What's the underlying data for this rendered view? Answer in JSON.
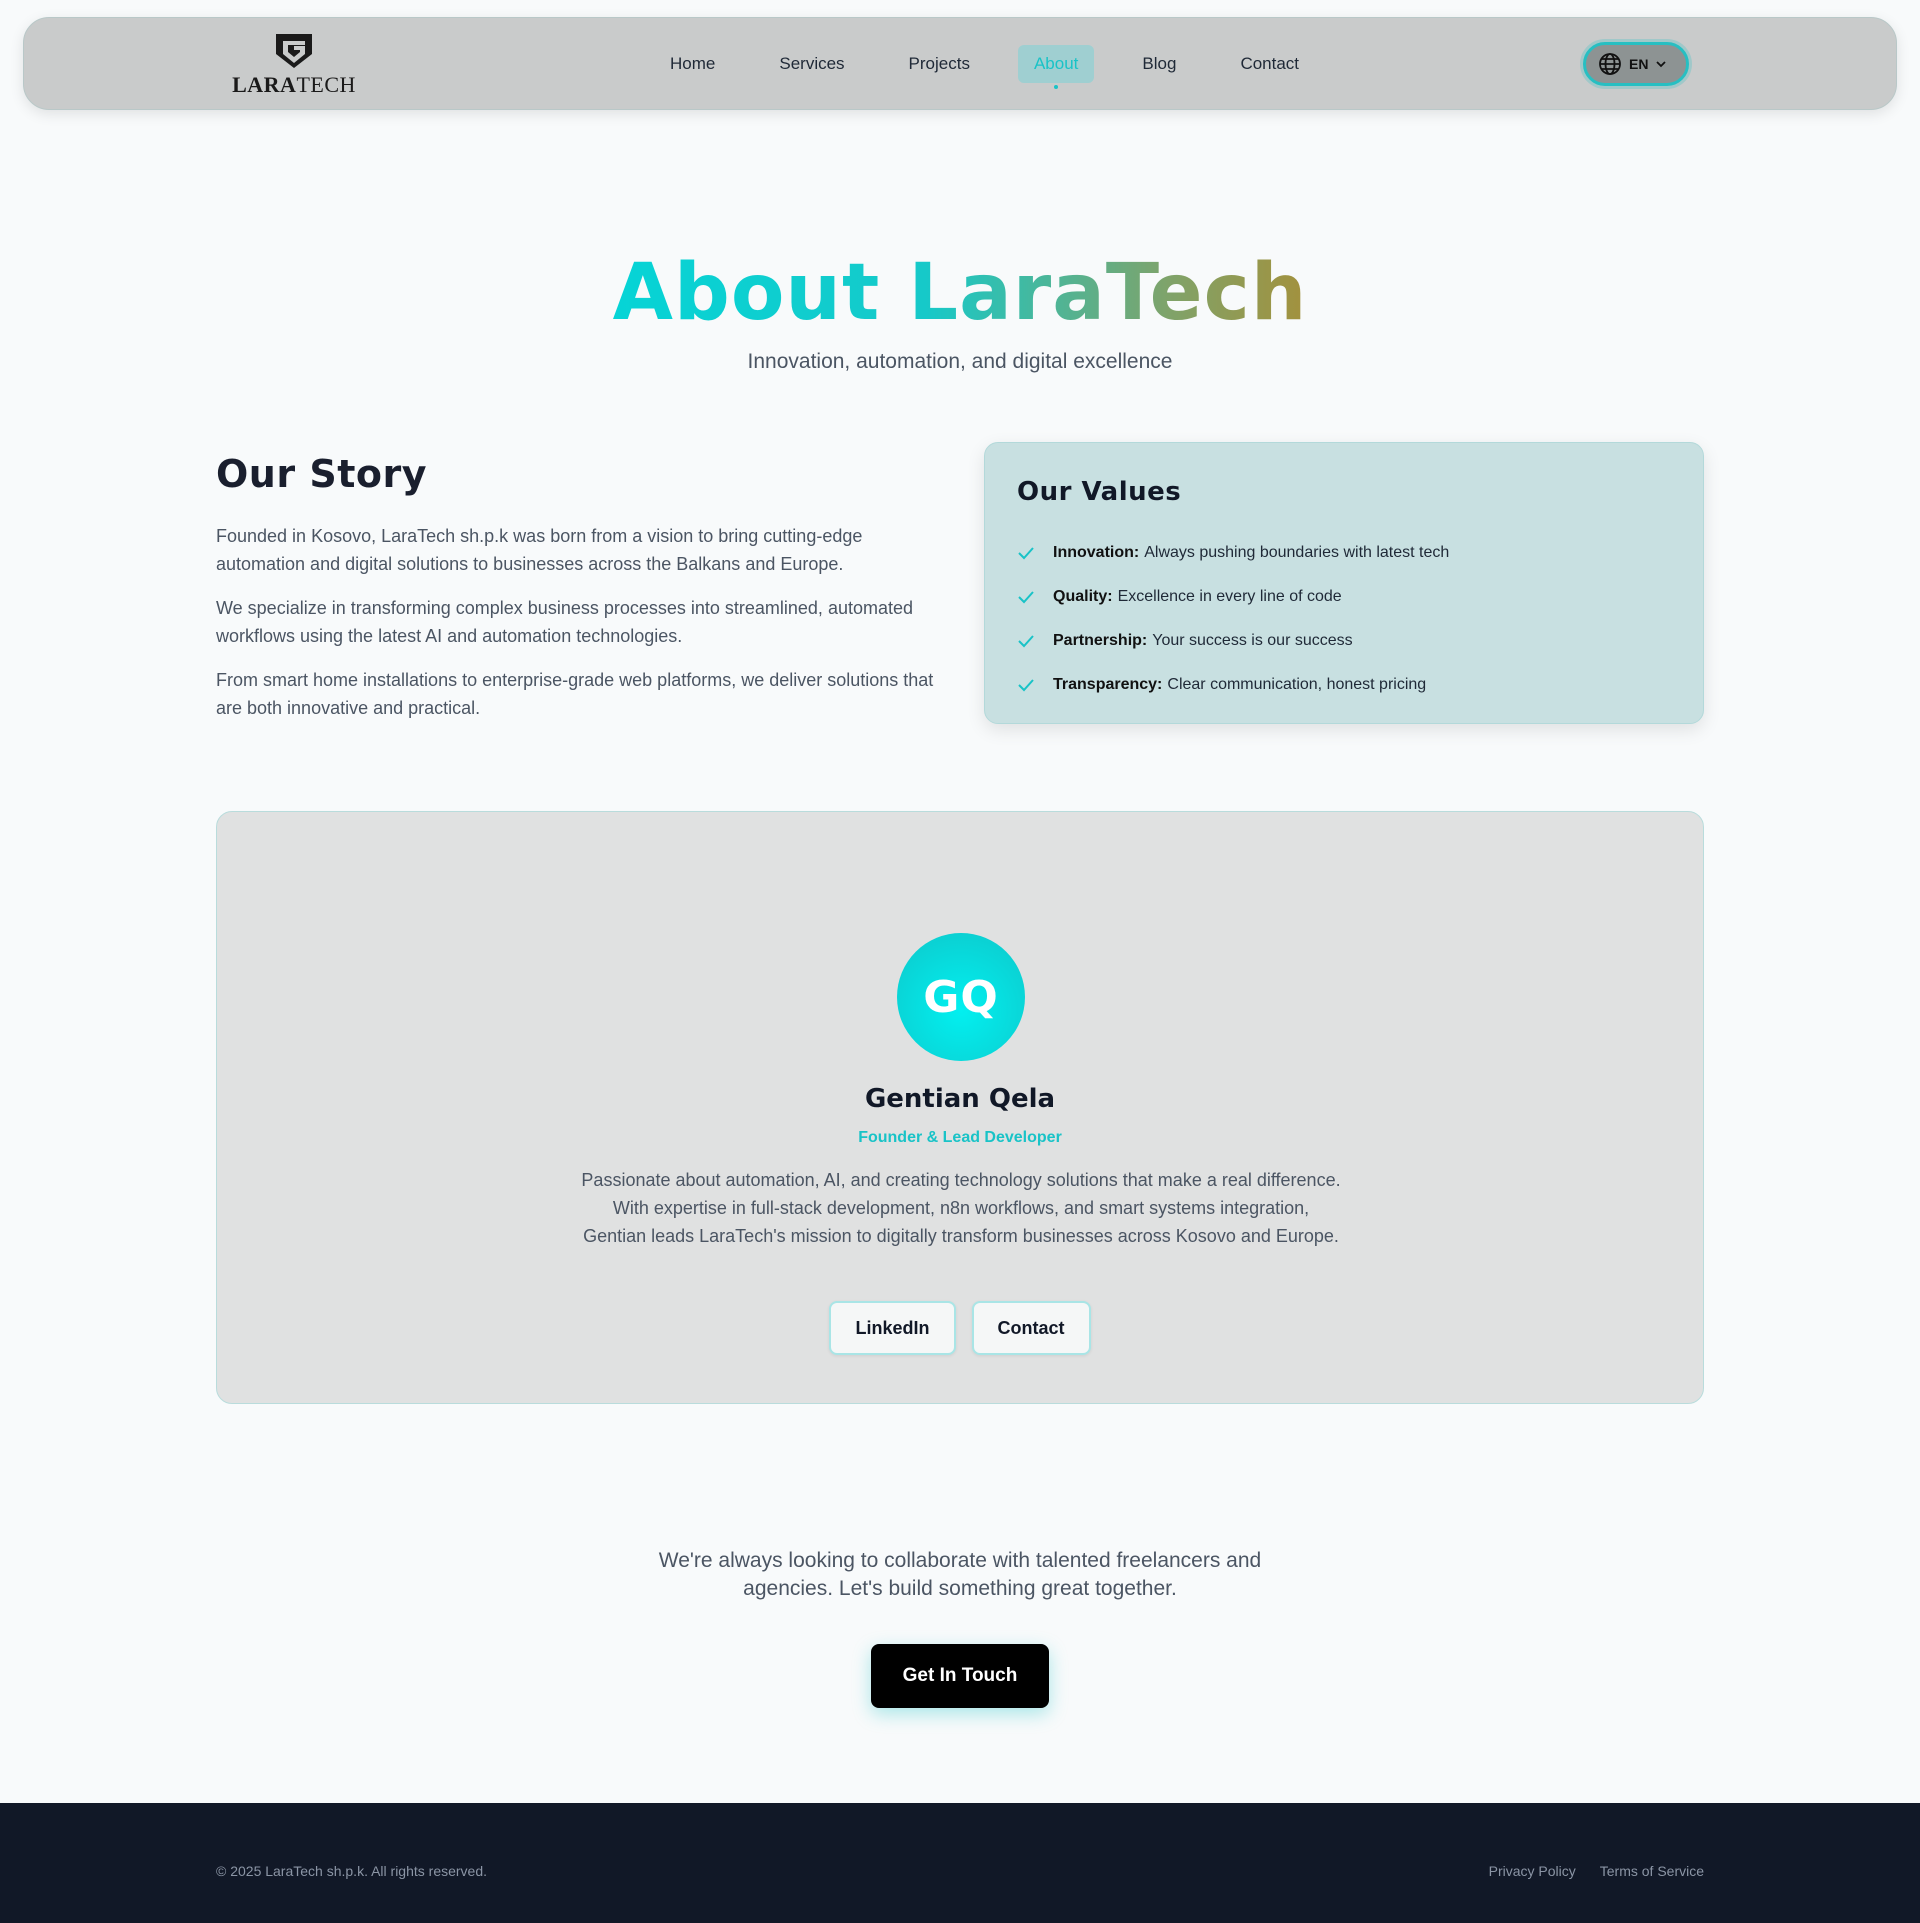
{
  "brand": {
    "logo_bold": "LARA",
    "logo_light": "TECH"
  },
  "nav": {
    "items": [
      {
        "label": "Home"
      },
      {
        "label": "Services"
      },
      {
        "label": "Projects"
      },
      {
        "label": "About",
        "active": true
      },
      {
        "label": "Blog"
      },
      {
        "label": "Contact"
      }
    ],
    "language": {
      "label": "EN",
      "icon": "globe-icon"
    }
  },
  "hero": {
    "title": "About LaraTech",
    "subtitle": "Innovation, automation, and digital excellence"
  },
  "story": {
    "title": "Our Story",
    "paragraphs": [
      "Founded in Kosovo, LaraTech sh.p.k was born from a vision to bring cutting-edge automation and digital solutions to businesses across the Balkans and Europe.",
      "We specialize in transforming complex business processes into streamlined, automated workflows using the latest AI and automation technologies.",
      "From smart home installations to enterprise-grade web platforms, we deliver solutions that are both innovative and practical."
    ]
  },
  "values": {
    "title": "Our Values",
    "items": [
      {
        "name": "Innovation:",
        "text": "Always pushing boundaries with latest tech"
      },
      {
        "name": "Quality:",
        "text": "Excellence in every line of code"
      },
      {
        "name": "Partnership:",
        "text": "Your success is our success"
      },
      {
        "name": "Transparency:",
        "text": "Clear communication, honest pricing"
      }
    ]
  },
  "team": {
    "initials": "GQ",
    "name": "Gentian Qela",
    "role": "Founder & Lead Developer",
    "bio": "Passionate about automation, AI, and creating technology solutions that make a real difference. With expertise in full-stack development, n8n workflows, and smart systems integration, Gentian leads LaraTech's mission to digitally transform businesses across Kosovo and Europe.",
    "buttons": {
      "linkedin": "LinkedIn",
      "contact": "Contact"
    }
  },
  "cta": {
    "text": "We're always looking to collaborate with talented freelancers and agencies. Let's build something great together.",
    "button": "Get In Touch"
  },
  "footer": {
    "copyright": "© 2025 LaraTech sh.p.k. All rights reserved.",
    "links": [
      "Privacy Policy",
      "Terms of Service"
    ]
  },
  "colors": {
    "accent": "#19c3c7",
    "footer_bg": "#111827",
    "page_bg": "#f8fafb"
  }
}
